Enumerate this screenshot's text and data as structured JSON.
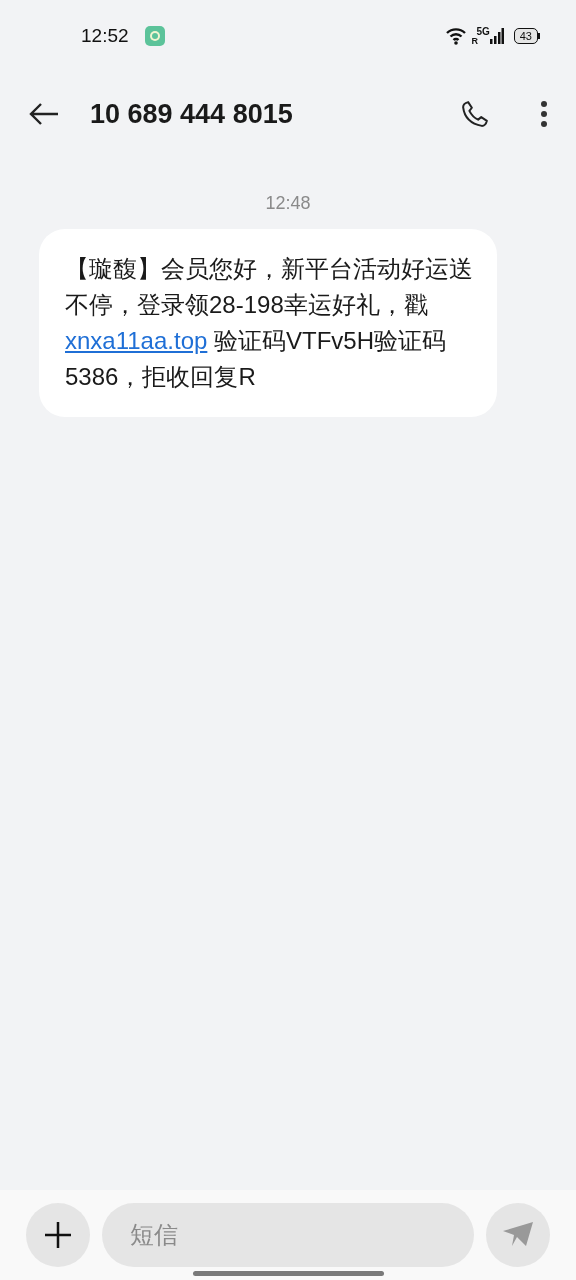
{
  "status_bar": {
    "time": "12:52",
    "network": "5G",
    "roaming": "R",
    "battery": "43"
  },
  "header": {
    "title": "10 689 444 8015"
  },
  "messages": [
    {
      "time": "12:48",
      "parts": [
        {
          "kind": "text",
          "text": "【璇馥】会员您好，新平台活动好运送不停，登录领28-198幸运好礼，戳 "
        },
        {
          "kind": "link",
          "text": "xnxa11aa.top"
        },
        {
          "kind": "text",
          "text": " 验证码VTFv5H验证码5386，拒收回复R"
        }
      ]
    }
  ],
  "composer": {
    "placeholder": "短信"
  }
}
